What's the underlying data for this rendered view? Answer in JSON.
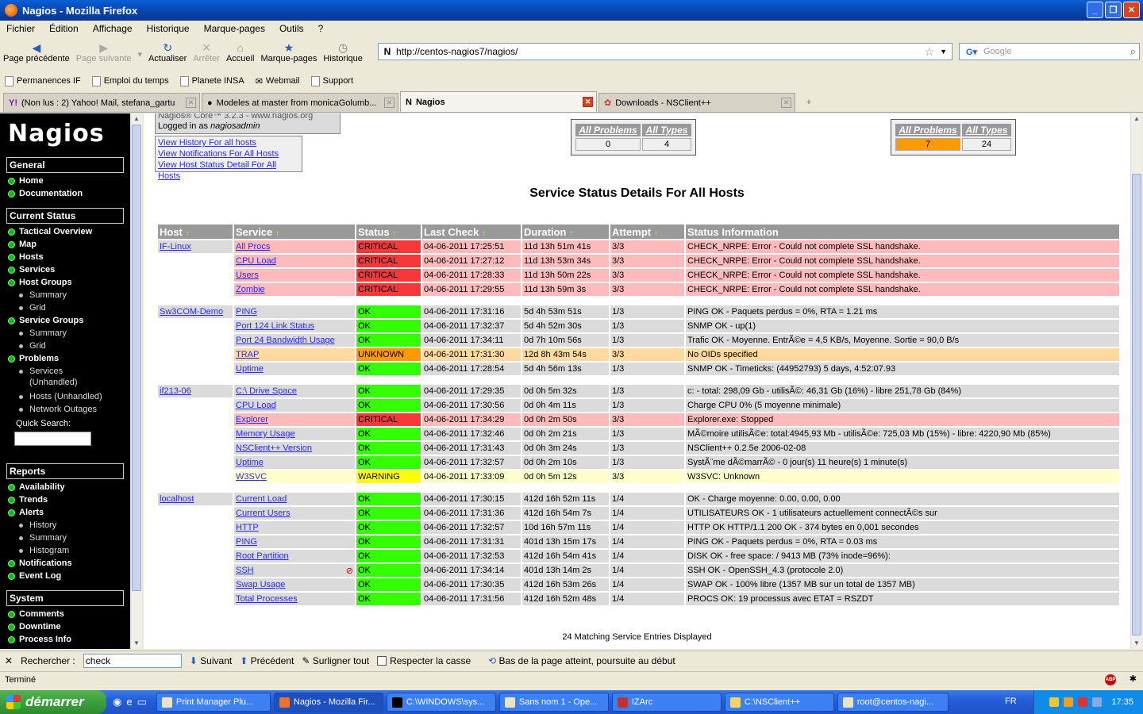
{
  "window": {
    "title": "Nagios - Mozilla Firefox"
  },
  "menu": [
    "Fichier",
    "Édition",
    "Affichage",
    "Historique",
    "Marque-pages",
    "Outils",
    "?"
  ],
  "nav": {
    "back": "Page précédente",
    "forward": "Page suivante",
    "reload": "Actualiser",
    "stop": "Arrêter",
    "home": "Accueil",
    "bookmarks": "Marque-pages",
    "history": "Historique"
  },
  "url": "http://centos-nagios7/nagios/",
  "search_placeholder": "Google",
  "bookmarks": [
    "Permanences IF",
    "Emploi du temps",
    "Planete INSA",
    "Webmail",
    "Support"
  ],
  "tabs": [
    "(Non lus : 2) Yahoo! Mail, stefana_gartu",
    "Modeles at master from monicaGolumb...",
    "Nagios",
    "Downloads - NSClient++"
  ],
  "sidebar": {
    "logo": "Nagios",
    "general": "General",
    "home": "Home",
    "documentation": "Documentation",
    "current_status": "Current Status",
    "tactical": "Tactical Overview",
    "map": "Map",
    "hosts": "Hosts",
    "services": "Services",
    "host_groups": "Host Groups",
    "hg_summary": "Summary",
    "hg_grid": "Grid",
    "service_groups": "Service Groups",
    "sg_summary": "Summary",
    "sg_grid": "Grid",
    "problems": "Problems",
    "p_services": "Services",
    "p_unhandled": "(Unhandled)",
    "p_hosts": "Hosts (Unhandled)",
    "p_outages": "Network Outages",
    "quick_search": "Quick Search:",
    "reports": "Reports",
    "availability": "Availability",
    "trends": "Trends",
    "alerts": "Alerts",
    "a_history": "History",
    "a_summary": "Summary",
    "a_histogram": "Histogram",
    "notifications": "Notifications",
    "eventlog": "Event Log",
    "system": "System",
    "comments": "Comments",
    "downtime": "Downtime",
    "process": "Process Info"
  },
  "main": {
    "logged_in_prefix": "Logged in as ",
    "user": "nagiosadmin",
    "version_line": "Nagios® Core™ 3.2.3 - www.nagios.org",
    "links": [
      "View History For all hosts",
      "View Notifications For All Hosts",
      "View Host Status Detail For All Hosts"
    ],
    "host_summary": {
      "h1": "All Problems",
      "h2": "All Types",
      "v1": "0",
      "v2": "4"
    },
    "service_summary": {
      "h1": "All Problems",
      "h2": "All Types",
      "v1": "7",
      "v2": "24"
    },
    "title": "Service Status Details For All Hosts",
    "columns": [
      "Host",
      "Service",
      "Status",
      "Last Check",
      "Duration",
      "Attempt",
      "Status Information"
    ],
    "footer": "24 Matching Service Entries Displayed"
  },
  "rows": [
    {
      "host": "IF-Linux",
      "service": "All Procs",
      "status": "CRITICAL",
      "last": "04-06-2011 17:25:51",
      "dur": "11d 13h 51m 41s",
      "att": "3/3",
      "info": "CHECK_NRPE: Error - Could not complete SSL handshake."
    },
    {
      "host": "",
      "service": "CPU Load",
      "status": "CRITICAL",
      "last": "04-06-2011 17:27:12",
      "dur": "11d 13h 53m 34s",
      "att": "3/3",
      "info": "CHECK_NRPE: Error - Could not complete SSL handshake."
    },
    {
      "host": "",
      "service": "Users",
      "status": "CRITICAL",
      "last": "04-06-2011 17:28:33",
      "dur": "11d 13h 50m 22s",
      "att": "3/3",
      "info": "CHECK_NRPE: Error - Could not complete SSL handshake."
    },
    {
      "host": "",
      "service": "Zombie",
      "status": "CRITICAL",
      "last": "04-06-2011 17:29:55",
      "dur": "11d 13h 59m 3s",
      "att": "3/3",
      "info": "CHECK_NRPE: Error - Could not complete SSL handshake."
    },
    {
      "spacer": true
    },
    {
      "host": "Sw3COM-Demo",
      "service": "PING",
      "status": "OK",
      "last": "04-06-2011 17:31:16",
      "dur": "5d 4h 53m 51s",
      "att": "1/3",
      "info": "PING OK - Paquets perdus = 0%, RTA = 1.21 ms"
    },
    {
      "host": "",
      "service": "Port 124 Link Status",
      "status": "OK",
      "last": "04-06-2011 17:32:37",
      "dur": "5d 4h 52m 30s",
      "att": "1/3",
      "info": "SNMP OK - up(1)"
    },
    {
      "host": "",
      "service": "Port 24 Bandwidth Usage",
      "status": "OK",
      "last": "04-06-2011 17:34:11",
      "dur": "0d 7h 10m 56s",
      "att": "1/3",
      "info": "Trafic OK - Moyenne. EntrÃ©e = 4,5 KB/s, Moyenne. Sortie = 90,0 B/s"
    },
    {
      "host": "",
      "service": "TRAP",
      "status": "UNKNOWN",
      "last": "04-06-2011 17:31:30",
      "dur": "12d 8h 43m 54s",
      "att": "3/3",
      "info": "No OIDs specified"
    },
    {
      "host": "",
      "service": "Uptime",
      "status": "OK",
      "last": "04-06-2011 17:28:54",
      "dur": "5d 4h 56m 13s",
      "att": "1/3",
      "info": "SNMP OK - Timeticks: (44952793) 5 days, 4:52:07.93"
    },
    {
      "spacer": true
    },
    {
      "host": "if213-06",
      "service": "C:\\ Drive Space",
      "status": "OK",
      "last": "04-06-2011 17:29:35",
      "dur": "0d 0h 5m 32s",
      "att": "1/3",
      "info": "c: - total: 298,09 Gb - utilisÃ©: 46,31 Gb (16%) - libre 251,78 Gb (84%)"
    },
    {
      "host": "",
      "service": "CPU Load",
      "status": "OK",
      "last": "04-06-2011 17:30:56",
      "dur": "0d 0h 4m 11s",
      "att": "1/3",
      "info": "Charge CPU 0% (5 moyenne minimale)"
    },
    {
      "host": "",
      "service": "Explorer",
      "status": "CRITICAL",
      "last": "04-06-2011 17:34:29",
      "dur": "0d 0h 2m 50s",
      "att": "3/3",
      "info": "Explorer.exe: Stopped"
    },
    {
      "host": "",
      "service": "Memory Usage",
      "status": "OK",
      "last": "04-06-2011 17:32:46",
      "dur": "0d 0h 2m 21s",
      "att": "1/3",
      "info": "MÃ©moire utilisÃ©e: total:4945,93 Mb - utilisÃ©e: 725,03 Mb (15%) - libre: 4220,90 Mb (85%)"
    },
    {
      "host": "",
      "service": "NSClient++ Version",
      "status": "OK",
      "last": "04-06-2011 17:31:43",
      "dur": "0d 0h 3m 24s",
      "att": "1/3",
      "info": "NSClient++ 0.2.5e 2006-02-08"
    },
    {
      "host": "",
      "service": "Uptime",
      "status": "OK",
      "last": "04-06-2011 17:32:57",
      "dur": "0d 0h 2m 10s",
      "att": "1/3",
      "info": "SystÃ¨me dÃ©marrÃ© - 0 jour(s) 11 heure(s) 1 minute(s)"
    },
    {
      "host": "",
      "service": "W3SVC",
      "status": "WARNING",
      "last": "04-06-2011 17:33:09",
      "dur": "0d 0h 5m 12s",
      "att": "3/3",
      "info": "W3SVC: Unknown"
    },
    {
      "spacer": true
    },
    {
      "host": "localhost",
      "service": "Current Load",
      "status": "OK",
      "last": "04-06-2011 17:30:15",
      "dur": "412d 16h 52m 11s",
      "att": "1/4",
      "info": "OK - Charge moyenne: 0.00, 0.00, 0.00"
    },
    {
      "host": "",
      "service": "Current Users",
      "status": "OK",
      "last": "04-06-2011 17:31:36",
      "dur": "412d 16h 54m 7s",
      "att": "1/4",
      "info": "UTILISATEURS OK - 1 utilisateurs actuellement connectÃ©s sur"
    },
    {
      "host": "",
      "service": "HTTP",
      "status": "OK",
      "last": "04-06-2011 17:32:57",
      "dur": "10d 16h 57m 11s",
      "att": "1/4",
      "info": "HTTP OK HTTP/1.1 200 OK - 374 bytes en 0,001 secondes"
    },
    {
      "host": "",
      "service": "PING",
      "status": "OK",
      "last": "04-06-2011 17:31:31",
      "dur": "401d 13h 15m 17s",
      "att": "1/4",
      "info": "PING OK - Paquets perdus = 0%, RTA = 0.03 ms"
    },
    {
      "host": "",
      "service": "Root Partition",
      "status": "OK",
      "last": "04-06-2011 17:32:53",
      "dur": "412d 16h 54m 41s",
      "att": "1/4",
      "info": "DISK OK - free space: / 9413 MB (73% inode=96%):"
    },
    {
      "host": "",
      "service": "SSH",
      "status": "OK",
      "last": "04-06-2011 17:34:14",
      "dur": "401d 13h 14m 2s",
      "att": "1/4",
      "info": "SSH OK - OpenSSH_4.3 (protocole 2.0)",
      "icon": true
    },
    {
      "host": "",
      "service": "Swap Usage",
      "status": "OK",
      "last": "04-06-2011 17:30:35",
      "dur": "412d 16h 53m 26s",
      "att": "1/4",
      "info": "SWAP OK - 100% libre (1357 MB sur un total de 1357 MB)"
    },
    {
      "host": "",
      "service": "Total Processes",
      "status": "OK",
      "last": "04-06-2011 17:31:56",
      "dur": "412d 16h 52m 48s",
      "att": "1/4",
      "info": "PROCS OK: 19 processus avec ETAT = RSZDT"
    }
  ],
  "findbar": {
    "label": "Rechercher :",
    "value": "check",
    "next": "Suivant",
    "prev": "Précédent",
    "highlight": "Surligner tout",
    "match_case": "Respecter la casse",
    "msg": "Bas de la page atteint, poursuite au début"
  },
  "status": "Terminé",
  "taskbar": {
    "start": "démarrer",
    "tasks": [
      "Print Manager Plu...",
      "Nagios - Mozilla Fir...",
      "C:\\WINDOWS\\sys...",
      "Sans nom 1 - Ope...",
      "IZArc",
      "C:\\NSClient++",
      "root@centos-nagi..."
    ],
    "lang": "FR",
    "clock": "17:35"
  }
}
